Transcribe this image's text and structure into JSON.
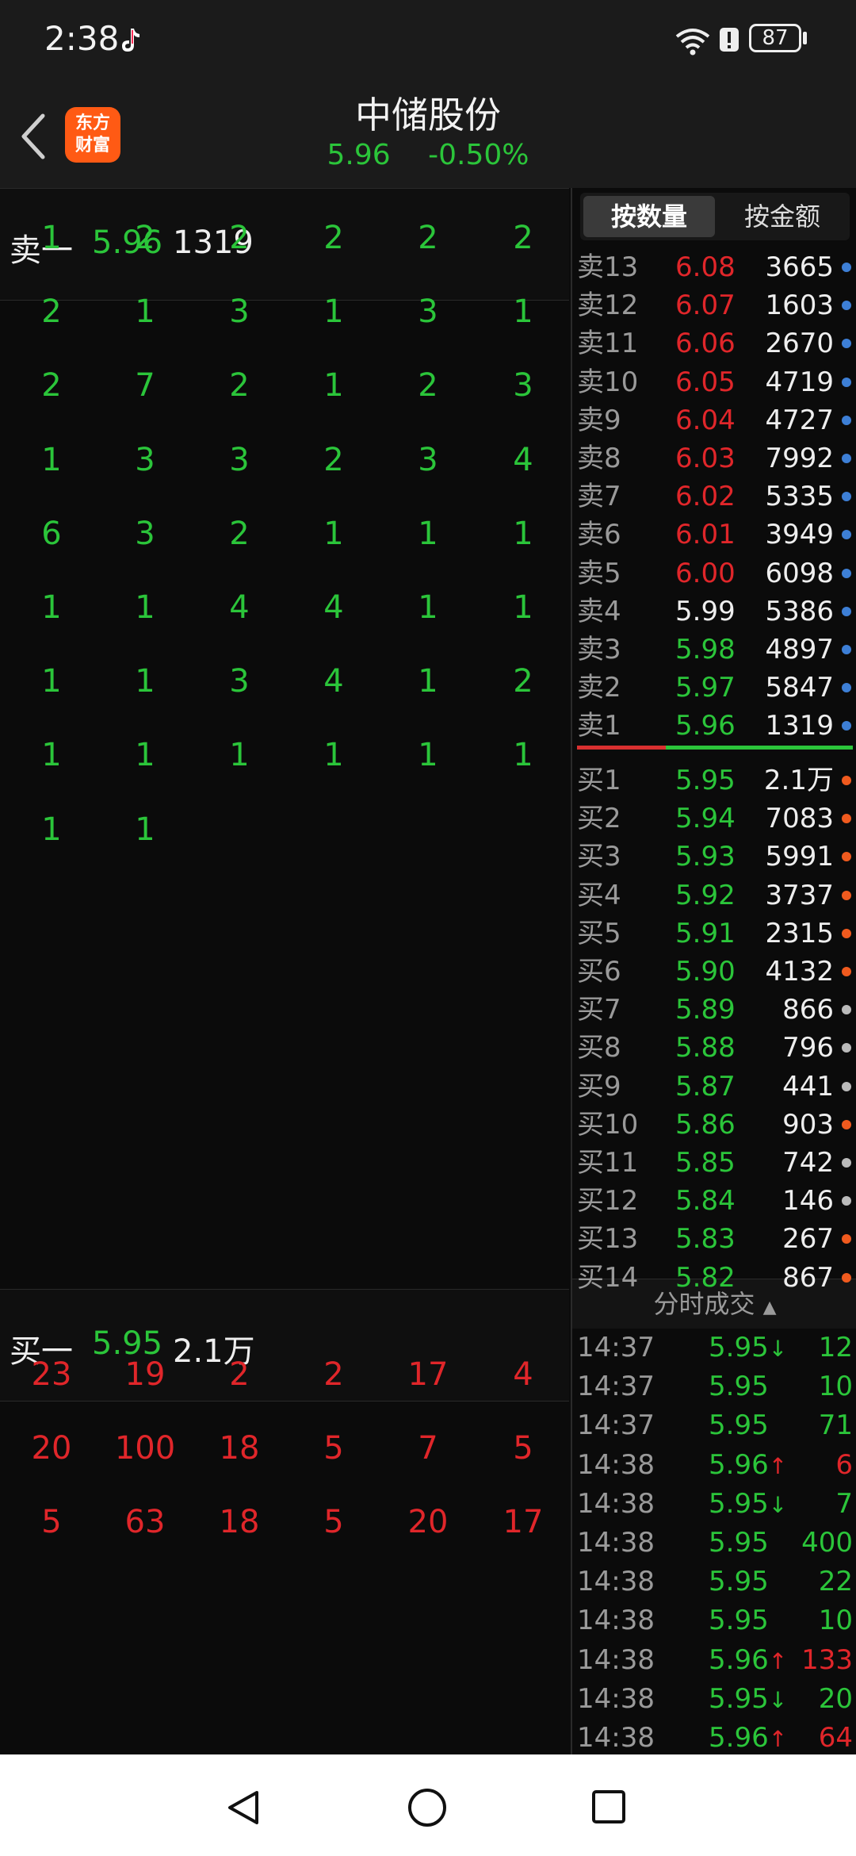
{
  "status_bar": {
    "time": "2:38",
    "battery": "87"
  },
  "header": {
    "title": "中储股份",
    "price": "5.96",
    "change": "-0.50%",
    "logo_line1": "东方",
    "logo_line2": "财富"
  },
  "queue": {
    "sell_level": {
      "label": "卖一",
      "price": "5.96",
      "volume": "1319"
    },
    "sell_orders": [
      [
        "1",
        "2",
        "2",
        "2",
        "2",
        "2"
      ],
      [
        "2",
        "1",
        "3",
        "1",
        "3",
        "1"
      ],
      [
        "2",
        "7",
        "2",
        "1",
        "2",
        "3"
      ],
      [
        "1",
        "3",
        "3",
        "2",
        "3",
        "4"
      ],
      [
        "6",
        "3",
        "2",
        "1",
        "1",
        "1"
      ],
      [
        "1",
        "1",
        "4",
        "4",
        "1",
        "1"
      ],
      [
        "1",
        "1",
        "3",
        "4",
        "1",
        "2"
      ],
      [
        "1",
        "1",
        "1",
        "1",
        "1",
        "1"
      ],
      [
        "1",
        "1"
      ]
    ],
    "buy_level": {
      "label": "买一",
      "price": "5.95",
      "volume": "2.1万"
    },
    "buy_orders": [
      [
        "23",
        "19",
        "2",
        "2",
        "17",
        "4"
      ],
      [
        "20",
        "100",
        "18",
        "5",
        "7",
        "5"
      ],
      [
        "5",
        "63",
        "18",
        "5",
        "20",
        "17"
      ]
    ]
  },
  "order_book": {
    "tab_quantity": "按数量",
    "tab_amount": "按金额",
    "asks": [
      {
        "label": "卖13",
        "price": "6.08",
        "vol": "3665",
        "color": "red"
      },
      {
        "label": "卖12",
        "price": "6.07",
        "vol": "1603",
        "color": "red"
      },
      {
        "label": "卖11",
        "price": "6.06",
        "vol": "2670",
        "color": "red"
      },
      {
        "label": "卖10",
        "price": "6.05",
        "vol": "4719",
        "color": "red"
      },
      {
        "label": "卖9",
        "price": "6.04",
        "vol": "4727",
        "color": "red"
      },
      {
        "label": "卖8",
        "price": "6.03",
        "vol": "7992",
        "color": "red"
      },
      {
        "label": "卖7",
        "price": "6.02",
        "vol": "5335",
        "color": "red"
      },
      {
        "label": "卖6",
        "price": "6.01",
        "vol": "3949",
        "color": "red"
      },
      {
        "label": "卖5",
        "price": "6.00",
        "vol": "6098",
        "color": "red"
      },
      {
        "label": "卖4",
        "price": "5.99",
        "vol": "5386",
        "color": "white"
      },
      {
        "label": "卖3",
        "price": "5.98",
        "vol": "4897",
        "color": "green"
      },
      {
        "label": "卖2",
        "price": "5.97",
        "vol": "5847",
        "color": "green"
      },
      {
        "label": "卖1",
        "price": "5.96",
        "vol": "1319",
        "color": "green"
      }
    ],
    "bids": [
      {
        "label": "买1",
        "price": "5.95",
        "vol": "2.1万",
        "dot": "orange"
      },
      {
        "label": "买2",
        "price": "5.94",
        "vol": "7083",
        "dot": "orange"
      },
      {
        "label": "买3",
        "price": "5.93",
        "vol": "5991",
        "dot": "orange"
      },
      {
        "label": "买4",
        "price": "5.92",
        "vol": "3737",
        "dot": "orange"
      },
      {
        "label": "买5",
        "price": "5.91",
        "vol": "2315",
        "dot": "orange"
      },
      {
        "label": "买6",
        "price": "5.90",
        "vol": "4132",
        "dot": "orange"
      },
      {
        "label": "买7",
        "price": "5.89",
        "vol": "866",
        "dot": "gray"
      },
      {
        "label": "买8",
        "price": "5.88",
        "vol": "796",
        "dot": "gray"
      },
      {
        "label": "买9",
        "price": "5.87",
        "vol": "441",
        "dot": "gray"
      },
      {
        "label": "买10",
        "price": "5.86",
        "vol": "903",
        "dot": "orange"
      },
      {
        "label": "买11",
        "price": "5.85",
        "vol": "742",
        "dot": "gray"
      },
      {
        "label": "买12",
        "price": "5.84",
        "vol": "146",
        "dot": "gray"
      },
      {
        "label": "买13",
        "price": "5.83",
        "vol": "267",
        "dot": "orange"
      },
      {
        "label": "买14",
        "price": "5.82",
        "vol": "867",
        "dot": "orange"
      }
    ]
  },
  "trades": {
    "header": "分时成交",
    "rows": [
      {
        "time": "14:37",
        "price": "5.95",
        "arrow": "↓",
        "vol": "12",
        "color": "green"
      },
      {
        "time": "14:37",
        "price": "5.95",
        "arrow": "",
        "vol": "10",
        "color": "green"
      },
      {
        "time": "14:37",
        "price": "5.95",
        "arrow": "",
        "vol": "71",
        "color": "green"
      },
      {
        "time": "14:38",
        "price": "5.96",
        "arrow": "↑",
        "vol": "6",
        "color": "red"
      },
      {
        "time": "14:38",
        "price": "5.95",
        "arrow": "↓",
        "vol": "7",
        "color": "green"
      },
      {
        "time": "14:38",
        "price": "5.95",
        "arrow": "",
        "vol": "400",
        "color": "green"
      },
      {
        "time": "14:38",
        "price": "5.95",
        "arrow": "",
        "vol": "22",
        "color": "green"
      },
      {
        "time": "14:38",
        "price": "5.95",
        "arrow": "",
        "vol": "10",
        "color": "green"
      },
      {
        "time": "14:38",
        "price": "5.96",
        "arrow": "↑",
        "vol": "133",
        "color": "red"
      },
      {
        "time": "14:38",
        "price": "5.95",
        "arrow": "↓",
        "vol": "20",
        "color": "green"
      },
      {
        "time": "14:38",
        "price": "5.96",
        "arrow": "↑",
        "vol": "64",
        "color": "red"
      }
    ]
  },
  "colors": {
    "up": "#e0262a",
    "down": "#2bc53a",
    "accent": "#ff5a14",
    "ask_dot": "#3d7fd6",
    "bid_dot": "#f05a1e",
    "neutral_dot": "#bbbbbb"
  }
}
